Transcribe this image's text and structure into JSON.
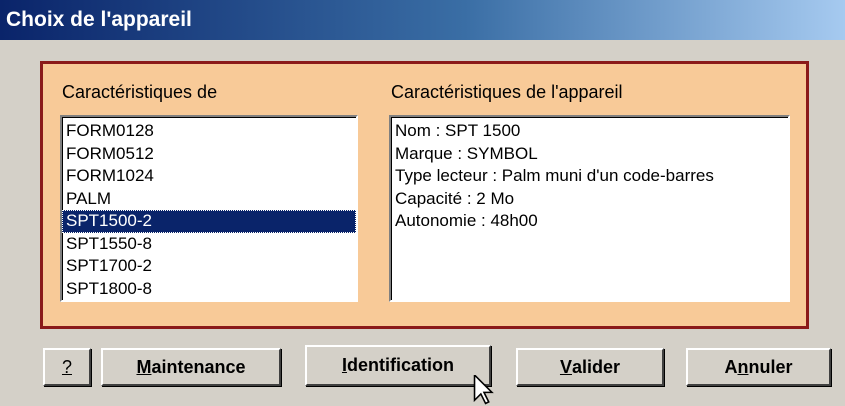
{
  "window": {
    "title": "Choix de l'appareil"
  },
  "left_panel": {
    "label": "Caractéristiques de",
    "devices": [
      "FORM0128",
      "FORM0512",
      "FORM1024",
      "PALM",
      "SPT1500-2",
      "SPT1550-8",
      "SPT1700-2",
      "SPT1800-8"
    ],
    "selected": "SPT1500-2"
  },
  "right_panel": {
    "label": "Caractéristiques de l'appareil",
    "lines": [
      "Nom : SPT 1500",
      "Marque : SYMBOL",
      "Type lecteur : Palm muni d'un code-barres",
      "Capacité : 2 Mo",
      "Autonomie : 48h00"
    ]
  },
  "buttons": {
    "help": {
      "label": "?"
    },
    "maintenance": {
      "accel": "M",
      "rest": "aintenance"
    },
    "identification": {
      "accel": "I",
      "rest": "dentification"
    },
    "valider": {
      "accel": "V",
      "rest": "alider"
    },
    "annuler": {
      "pre": "A",
      "accel": "n",
      "rest": "nuler"
    }
  },
  "icons": {
    "cursor": "arrow-cursor-icon"
  }
}
